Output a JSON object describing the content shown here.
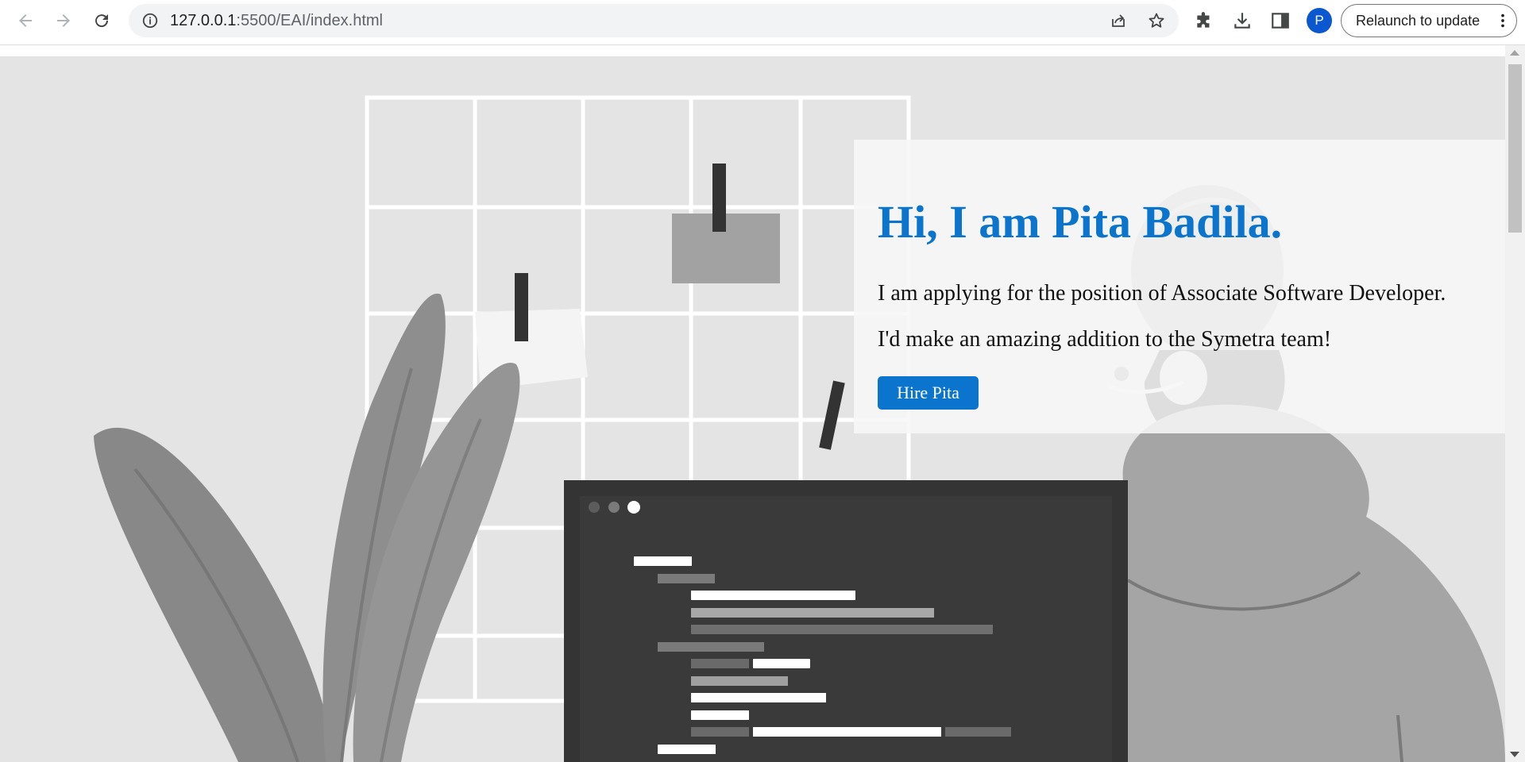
{
  "browser": {
    "url_host": "127.0.0.1",
    "url_rest": ":5500/EAI/index.html",
    "profile_initial": "P",
    "relaunch_label": "Relaunch to update",
    "icons": {
      "back": "arrow-left-icon",
      "forward": "arrow-right-icon",
      "reload": "reload-icon",
      "site_info": "info-icon",
      "share": "share-icon",
      "bookmark": "star-icon",
      "extensions": "puzzle-icon",
      "downloads": "download-icon",
      "side_panel": "side-panel-icon",
      "menu": "vertical-dots-icon"
    },
    "accent_color": "#0b57d0"
  },
  "hero": {
    "heading": "Hi, I am Pita Badila.",
    "line1": "I am applying for the position of Associate Software Developer.",
    "line2": "I'd make an amazing addition to the Symetra team!",
    "button_label": "Hire Pita",
    "heading_color": "#0b74cc",
    "button_color": "#0b74cc",
    "illustration": "grayscale-developer-at-computer-illustration"
  }
}
